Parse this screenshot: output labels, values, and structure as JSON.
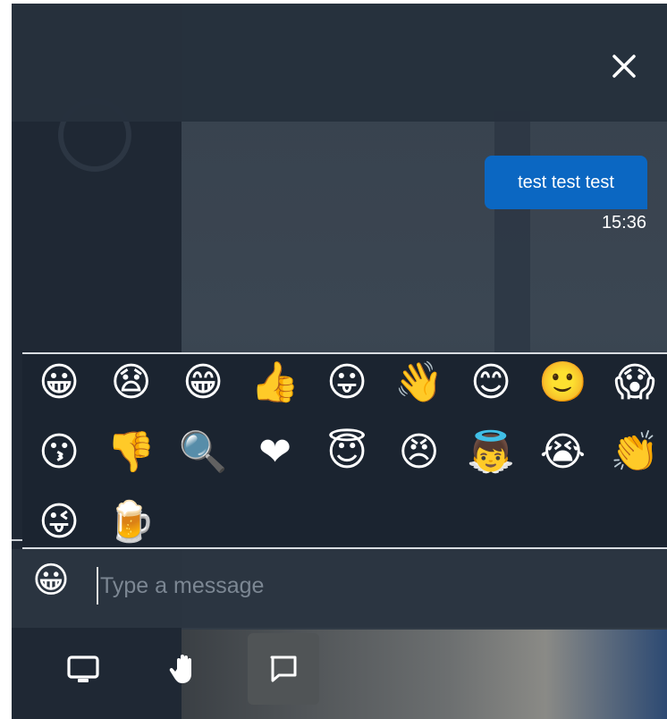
{
  "chat": {
    "messages": [
      {
        "text": "test test test",
        "time": "15:36"
      }
    ]
  },
  "emoji_panel": {
    "emojis": [
      {
        "glyph": "😀",
        "name": "grinning-face"
      },
      {
        "glyph": "😧",
        "name": "anguished-face"
      },
      {
        "glyph": "😁",
        "name": "grinning-face-with-smiling-eyes"
      },
      {
        "glyph": "👍",
        "name": "thumbs-up"
      },
      {
        "glyph": "😛",
        "name": "face-with-tongue"
      },
      {
        "glyph": "👋",
        "name": "waving-hand"
      },
      {
        "glyph": "😊",
        "name": "smiling-face-with-smiling-eyes"
      },
      {
        "glyph": "🙂",
        "name": "slightly-smiling-face"
      },
      {
        "glyph": "😱",
        "name": "face-screaming-in-fear"
      },
      {
        "glyph": "😗",
        "name": "kissing-face"
      },
      {
        "glyph": "👎",
        "name": "thumbs-down"
      },
      {
        "glyph": "🔍",
        "name": "magnifying-glass"
      },
      {
        "glyph": "❤",
        "name": "heart"
      },
      {
        "glyph": "😇",
        "name": "smiling-face-with-halo"
      },
      {
        "glyph": "😠",
        "name": "angry-face"
      },
      {
        "glyph": "👼",
        "name": "baby-angel"
      },
      {
        "glyph": "😭",
        "name": "loudly-crying-face"
      },
      {
        "glyph": "👏",
        "name": "clapping-hands"
      },
      {
        "glyph": "😜",
        "name": "winking-face-with-tongue"
      },
      {
        "glyph": "🍺",
        "name": "beer-mug"
      }
    ]
  },
  "input": {
    "placeholder": "Type a message",
    "emoji_button_glyph": "😀"
  },
  "toolbar": {
    "buttons": [
      {
        "name": "screen-share-button",
        "icon": "monitor-icon",
        "active": false
      },
      {
        "name": "raise-hand-button",
        "icon": "hand-icon",
        "active": false
      },
      {
        "name": "chat-button",
        "icon": "chat-bubble-icon",
        "active": true
      }
    ]
  },
  "colors": {
    "accent": "#0b67c2",
    "panel": "#1b2430",
    "header": "#26313d",
    "active_tool": "#505456"
  }
}
